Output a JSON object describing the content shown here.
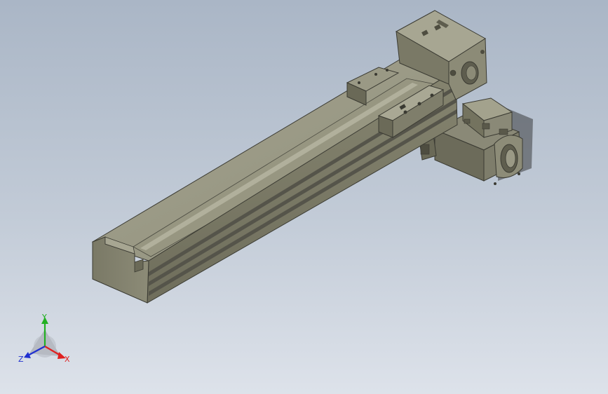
{
  "viewport": {
    "background_top": "#aab6c6",
    "background_bottom": "#dde2ea"
  },
  "colors": {
    "body_top": "#9c9b86",
    "body_side": "#7d7c69",
    "body_dark": "#5e5d4e",
    "edge": "#3a3a32",
    "slot": "#4a4a40"
  },
  "triad": {
    "x_label": "X",
    "y_label": "Y",
    "z_label": "Z",
    "x_color": "#e02020",
    "y_color": "#22b022",
    "z_color": "#2030d0"
  }
}
